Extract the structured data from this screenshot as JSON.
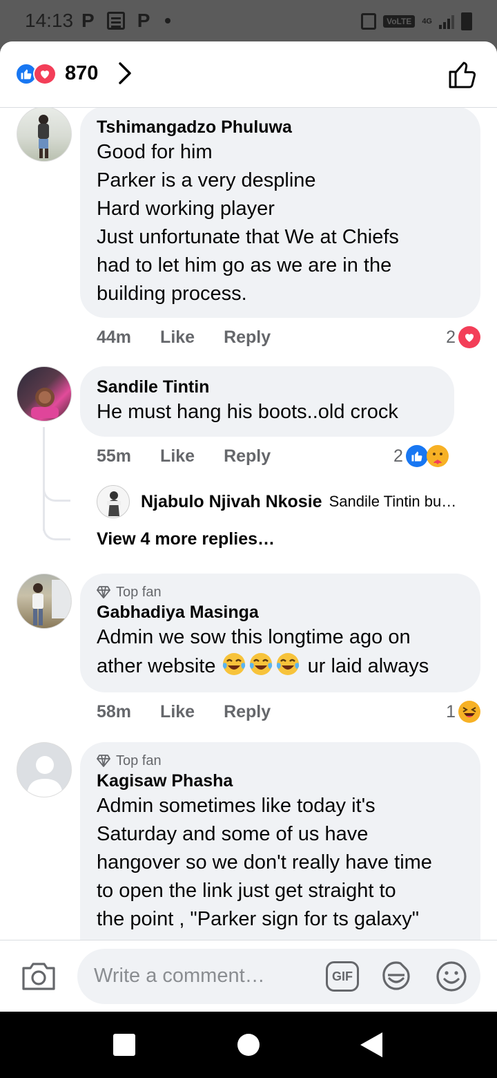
{
  "status_bar": {
    "time": "14:13",
    "left_icons": [
      "P",
      "news-icon",
      "P"
    ],
    "volte": "VoLTE",
    "network": "4G"
  },
  "header": {
    "reaction_count": "870"
  },
  "comments": [
    {
      "author": "Tshimangadzo Phuluwa",
      "lines": [
        "Good for him",
        "Parker is a very despline",
        "Hard working player",
        "Just unfortunate that We at Chiefs",
        "had to let him go as we are in the",
        "building process."
      ],
      "time": "44m",
      "like_label": "Like",
      "reply_label": "Reply",
      "reaction_count": "2",
      "reactions": [
        "heart-icon"
      ]
    },
    {
      "author": "Sandile Tintin",
      "lines": [
        "He must hang his boots..old crock"
      ],
      "time": "55m",
      "like_label": "Like",
      "reply_label": "Reply",
      "reaction_count": "2",
      "reactions": [
        "like-icon",
        "care-icon"
      ],
      "reply_preview": {
        "author": "Njabulo Njivah Nkosie",
        "text": "Sandile Tintin bu…"
      },
      "view_more": "View 4 more replies…"
    },
    {
      "badge": "Top fan",
      "author": "Gabhadiya Masinga",
      "line1": "Admin we sow this longtime ago on",
      "line2_pre": "ather website ",
      "line2_post": " ur laid always",
      "time": "58m",
      "like_label": "Like",
      "reply_label": "Reply",
      "reaction_count": "1",
      "reactions": [
        "haha-icon"
      ]
    },
    {
      "badge": "Top fan",
      "author": "Kagisaw Phasha",
      "lines": [
        "Admin sometimes like today it's",
        "Saturday and some of us have",
        "hangover so we don't really have time",
        "to open the link just get straight to",
        "the point , \"Parker sign for ts galaxy\""
      ]
    }
  ],
  "composer": {
    "placeholder": "Write a comment…",
    "gif_label": "GIF"
  },
  "colors": {
    "facebook_blue": "#1877f2",
    "love_red": "#f33e58",
    "bubble_bg": "#f0f2f5",
    "secondary_text": "#65676b"
  }
}
